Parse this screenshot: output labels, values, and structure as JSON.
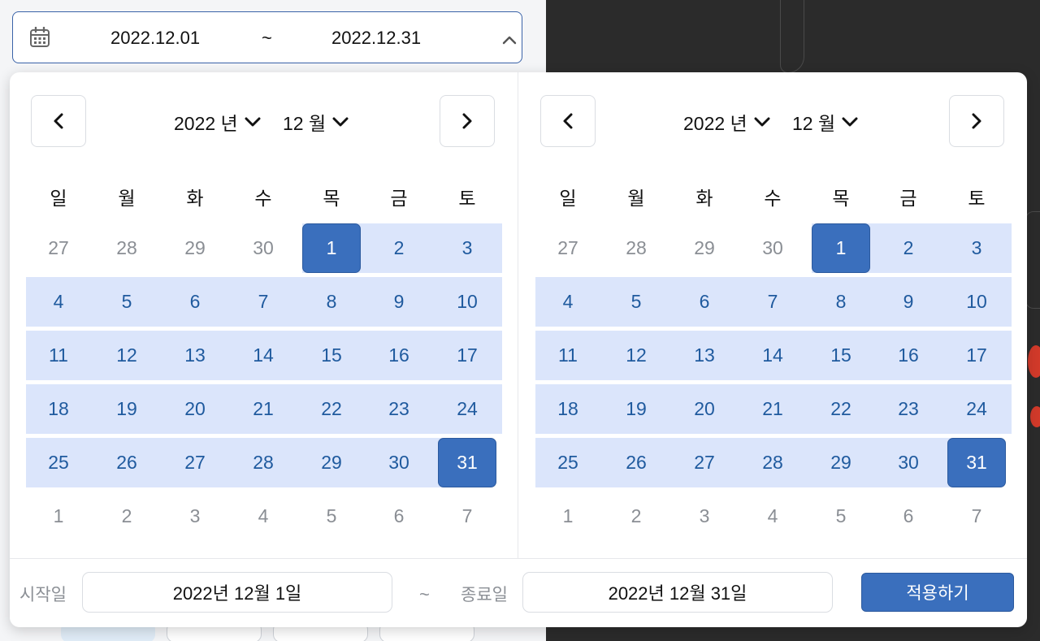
{
  "range_input": {
    "start": "2022.12.01",
    "separator": "~",
    "end": "2022.12.31"
  },
  "calendars": [
    {
      "year_label": "2022 년",
      "month_label": "12 월",
      "weekdays": [
        "일",
        "월",
        "화",
        "수",
        "목",
        "금",
        "토"
      ],
      "weeks": [
        [
          "27",
          "28",
          "29",
          "30",
          "1",
          "2",
          "3"
        ],
        [
          "4",
          "5",
          "6",
          "7",
          "8",
          "9",
          "10"
        ],
        [
          "11",
          "12",
          "13",
          "14",
          "15",
          "16",
          "17"
        ],
        [
          "18",
          "19",
          "20",
          "21",
          "22",
          "23",
          "24"
        ],
        [
          "25",
          "26",
          "27",
          "28",
          "29",
          "30",
          "31"
        ],
        [
          "1",
          "2",
          "3",
          "4",
          "5",
          "6",
          "7"
        ]
      ]
    },
    {
      "year_label": "2022 년",
      "month_label": "12 월",
      "weekdays": [
        "일",
        "월",
        "화",
        "수",
        "목",
        "금",
        "토"
      ],
      "weeks": [
        [
          "27",
          "28",
          "29",
          "30",
          "1",
          "2",
          "3"
        ],
        [
          "4",
          "5",
          "6",
          "7",
          "8",
          "9",
          "10"
        ],
        [
          "11",
          "12",
          "13",
          "14",
          "15",
          "16",
          "17"
        ],
        [
          "18",
          "19",
          "20",
          "21",
          "22",
          "23",
          "24"
        ],
        [
          "25",
          "26",
          "27",
          "28",
          "29",
          "30",
          "31"
        ],
        [
          "1",
          "2",
          "3",
          "4",
          "5",
          "6",
          "7"
        ]
      ]
    }
  ],
  "footer": {
    "start_label": "시작일",
    "start_value": "2022년 12월 1일",
    "separator": "~",
    "end_label": "종료일",
    "end_value": "2022년 12월 31일",
    "apply_label": "적용하기"
  },
  "colors": {
    "accent": "#3a6fbd",
    "range_fill": "#dbe5fb",
    "in_month_text": "#1f5a9e",
    "other_month_text": "#8a8e94"
  }
}
